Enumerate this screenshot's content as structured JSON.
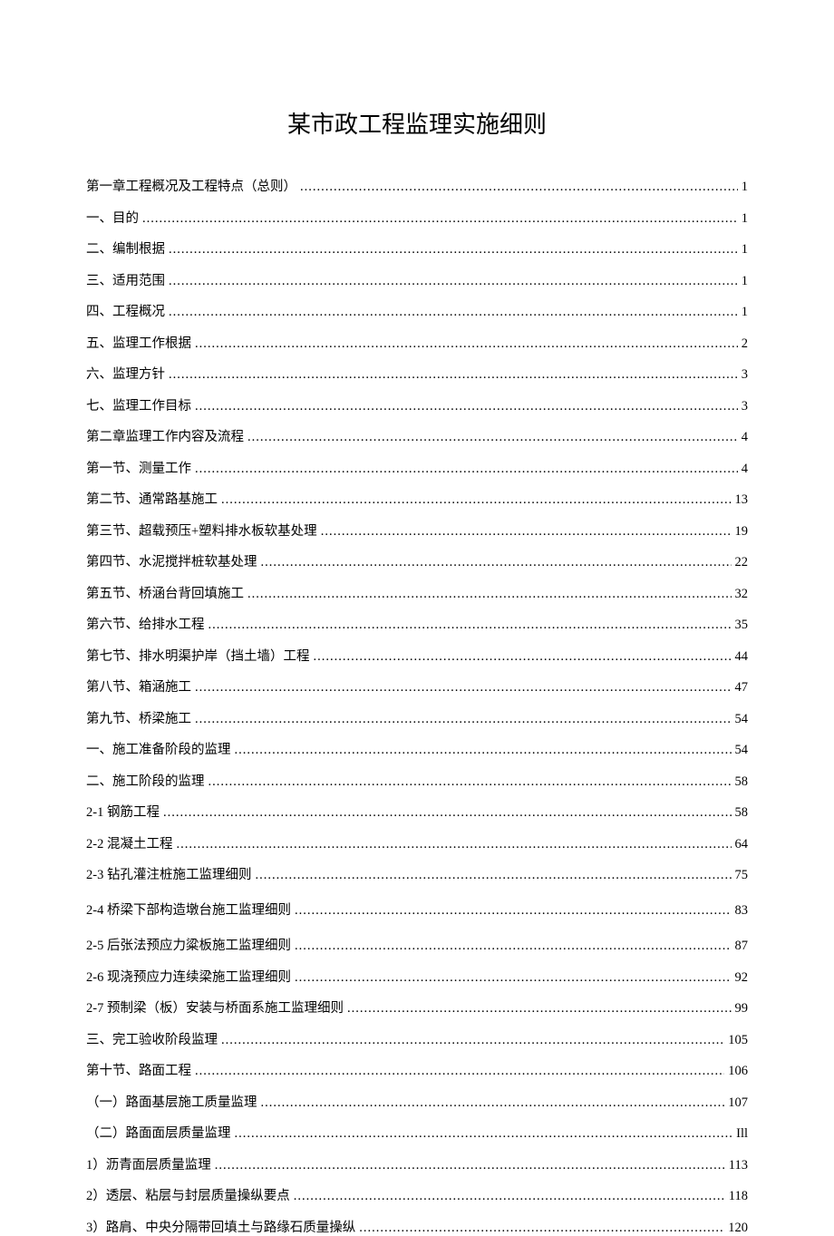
{
  "title": "某市政工程监理实施细则",
  "toc": [
    {
      "label": "第一章工程概况及工程特点（总则）",
      "page": "1"
    },
    {
      "label": "一、目的",
      "page": "1"
    },
    {
      "label": "二、编制根据",
      "page": "1"
    },
    {
      "label": "三、适用范围",
      "page": "1"
    },
    {
      "label": "四、工程概况",
      "page": "1"
    },
    {
      "label": "五、监理工作根据",
      "page": "2"
    },
    {
      "label": "六、监理方针",
      "page": "3"
    },
    {
      "label": "七、监理工作目标",
      "page": "3"
    },
    {
      "label": "第二章监理工作内容及流程",
      "page": "4"
    },
    {
      "label": "第一节、测量工作",
      "page": "4"
    },
    {
      "label": "第二节、通常路基施工",
      "page": "13"
    },
    {
      "label": "第三节、超载预压+塑料排水板软基处理",
      "page": "19"
    },
    {
      "label": "第四节、水泥搅拌桩软基处理",
      "page": "22"
    },
    {
      "label": "第五节、桥涵台背回填施工",
      "page": "32"
    },
    {
      "label": "第六节、给排水工程",
      "page": "35"
    },
    {
      "label": "第七节、排水明渠护岸（挡土墙）工程",
      "page": "44"
    },
    {
      "label": "第八节、箱涵施工",
      "page": "47"
    },
    {
      "label": "第九节、桥梁施工",
      "page": "54"
    },
    {
      "label": "一、施工准备阶段的监理",
      "page": "54"
    },
    {
      "label": "二、施工阶段的监理",
      "page": "58"
    },
    {
      "label": "2-1 钢筋工程",
      "page": "58"
    },
    {
      "label": "2-2 混凝土工程",
      "page": "64"
    },
    {
      "label": "2-3 钻孔灌注桩施工监理细则",
      "page": "75"
    },
    {
      "label": "2-4 桥梁下部构造墩台施工监理细则",
      "page": "83",
      "gap": true
    },
    {
      "label": "2-5 后张法预应力粱板施工监理细则",
      "page": "87",
      "gap": true
    },
    {
      "label": "2-6 现浇预应力连续梁施工监理细则",
      "page": "92"
    },
    {
      "label": "2-7 预制梁（板）安装与桥面系施工监理细则",
      "page": "99"
    },
    {
      "label": "三、完工验收阶段监理",
      "page": "105"
    },
    {
      "label": "第十节、路面工程",
      "page": "106"
    },
    {
      "label": "（一）路面基层施工质量监理",
      "page": "107"
    },
    {
      "label": "（二）路面面层质量监理",
      "page": "Ill"
    },
    {
      "label": "1）沥青面层质量监理",
      "page": "113"
    },
    {
      "label": "2）透层、粘层与封层质量操纵要点",
      "page": "118"
    },
    {
      "label": "3）路肩、中央分隔带回填土与路缘石质量操纵",
      "page": "120"
    }
  ]
}
